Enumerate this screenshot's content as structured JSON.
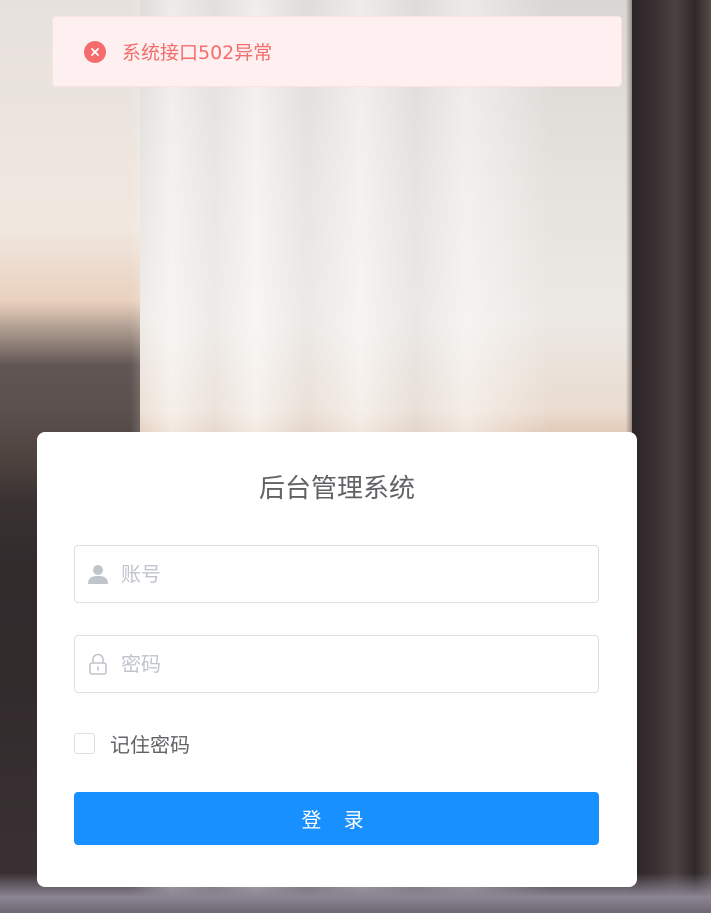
{
  "toast": {
    "message": "系统接口502异常",
    "type": "error",
    "color": "#f56c6c"
  },
  "login": {
    "title": "后台管理系统",
    "username": {
      "placeholder": "账号",
      "value": ""
    },
    "password": {
      "placeholder": "密码",
      "value": ""
    },
    "remember_label": "记住密码",
    "remember_checked": false,
    "submit_label": "登 录"
  },
  "colors": {
    "primary": "#1890ff",
    "error": "#f56c6c",
    "text": "#606266",
    "placeholder": "#c0c4cc"
  }
}
